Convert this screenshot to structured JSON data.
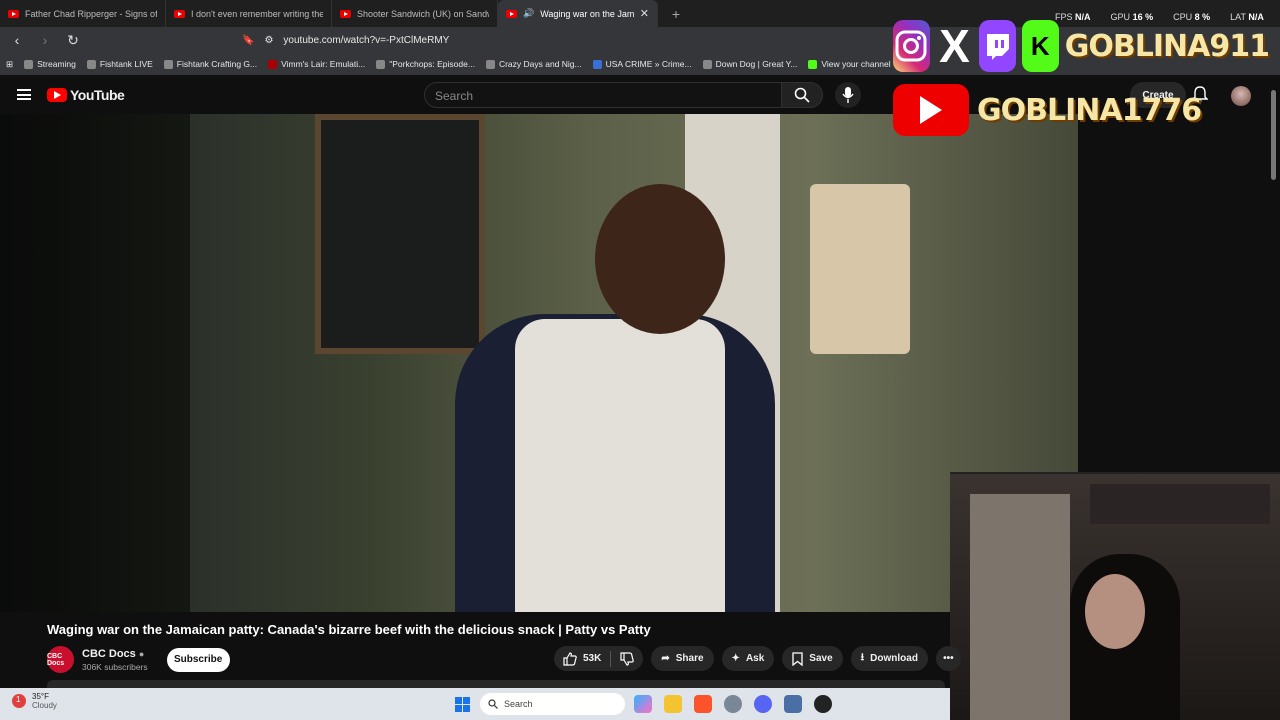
{
  "browser": {
    "tabs": [
      {
        "label": "Father Chad Ripperger - Signs of the",
        "active": false
      },
      {
        "label": "I don't even remember writing these ",
        "active": false
      },
      {
        "label": "Shooter Sandwich (UK) on Sandwiche",
        "active": false
      },
      {
        "label": "Waging war on the Jamaican",
        "active": true
      }
    ],
    "new_tab": "+",
    "url": "youtube.com/watch?v=-PxtClMeRMY",
    "bookmarks": [
      "Streaming",
      "Fishtank LIVE",
      "Fishtank Crafting G...",
      "Vimm's Lair: Emulati...",
      "\"Porkchops: Episode...",
      "Crazy Days and Nig...",
      "USA CRIME » Crime...",
      "Down Dog | Great Y...",
      "View your channel"
    ]
  },
  "youtube": {
    "logo": "YouTube",
    "search_placeholder": "Search",
    "create_label": "Create"
  },
  "overlay": {
    "stats": [
      {
        "label": "FPS",
        "value": "N/A"
      },
      {
        "label": "GPU",
        "value": "16 %"
      },
      {
        "label": "CPU",
        "value": "8 %"
      },
      {
        "label": "LAT",
        "value": "N/A"
      }
    ],
    "handle1": "GOBLINA911",
    "handle2": "GOBLINA1776",
    "kick_letter": "K",
    "x_letter": "X"
  },
  "video": {
    "title": "Waging war on the Jamaican patty: Canada's bizarre beef with the delicious snack | Patty vs Patty",
    "channel_name": "CBC Docs",
    "channel_avatar_text": "CBC Docs",
    "subscribers": "306K subscribers",
    "subscribe_label": "Subscribe",
    "likes": "53K",
    "share_label": "Share",
    "ask_label": "Ask",
    "save_label": "Save",
    "download_label": "Download"
  },
  "taskbar": {
    "temperature": "35°F",
    "condition": "Cloudy",
    "weather_badge": "1",
    "search_label": "Search"
  },
  "colors": {
    "youtube_red": "#ff0000",
    "kick_green": "#53fc18",
    "twitch_purple": "#9146ff",
    "cbc_red": "#c8102e"
  }
}
